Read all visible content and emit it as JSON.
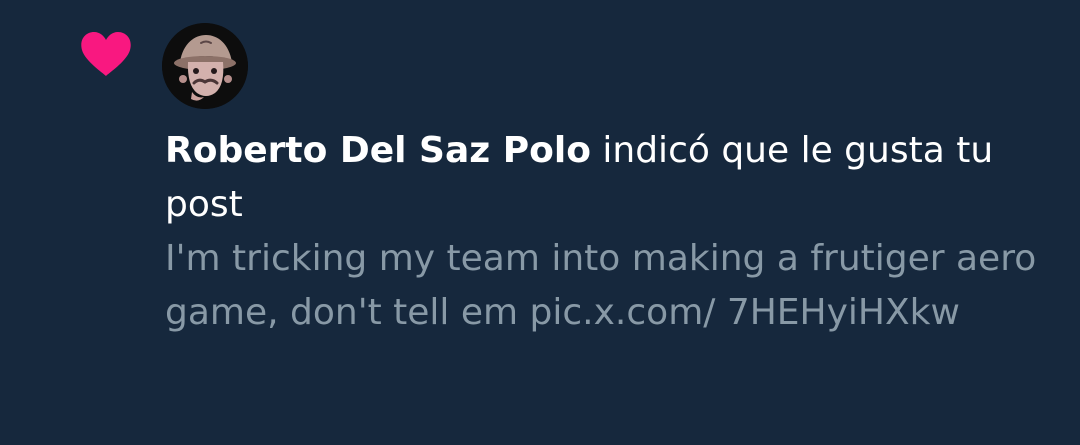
{
  "notification": {
    "icon": "heart-icon",
    "icon_color": "#f91880",
    "avatar": "avatar-icon",
    "author_name": "Roberto Del Saz Polo",
    "action_text": "indicó que le gusta tu post",
    "post_text": "I'm tricking my team into making a frutiger aero game, don't tell em pic.x.com/ 7HEHyiHXkw"
  },
  "colors": {
    "background": "#16283d",
    "primary_text": "#ffffff",
    "secondary_text": "#8899a6",
    "like_pink": "#f91880"
  }
}
